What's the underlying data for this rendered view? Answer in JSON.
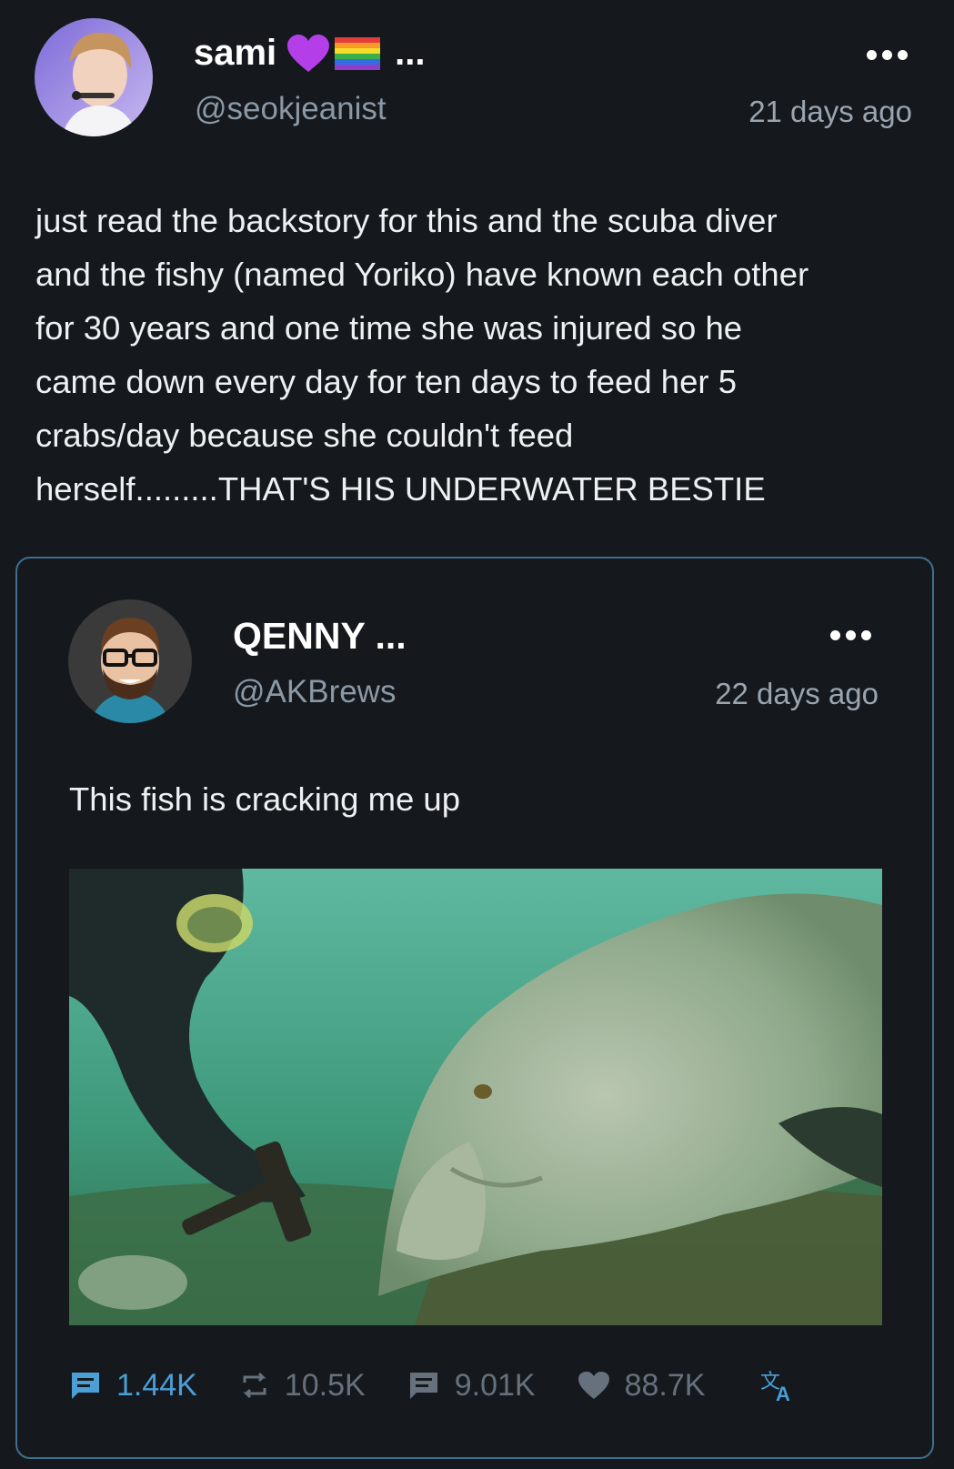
{
  "post": {
    "display_name": "sami",
    "name_suffix": "...",
    "handle": "@seokjeanist",
    "time": "21 days ago",
    "body_lines": [
      "just read the backstory for this and the scuba diver",
      "and the fishy (named Yoriko) have known each other",
      "for 30 years and one time she was injured so he",
      "came down every day for ten days to feed her 5",
      "crabs/day because she couldn't feed",
      "herself.........THAT'S HIS UNDERWATER BESTIE"
    ]
  },
  "quoted": {
    "display_name": "QENNY ...",
    "handle": "@AKBrews",
    "time": "22 days ago",
    "text": "This fish is cracking me up"
  },
  "actions": {
    "comments": "1.44K",
    "retweets": "10.5K",
    "quotes": "9.01K",
    "likes": "88.7K"
  },
  "icons": {
    "more": "more-dots-icon",
    "comment": "comment-icon",
    "retweet": "retweet-icon",
    "quote": "quote-icon",
    "like": "heart-icon",
    "translate": "translate-icon"
  },
  "colors": {
    "background": "#15181c",
    "accent": "#4a9fd6",
    "card_border": "#3d6f8e",
    "muted": "#66717d"
  }
}
